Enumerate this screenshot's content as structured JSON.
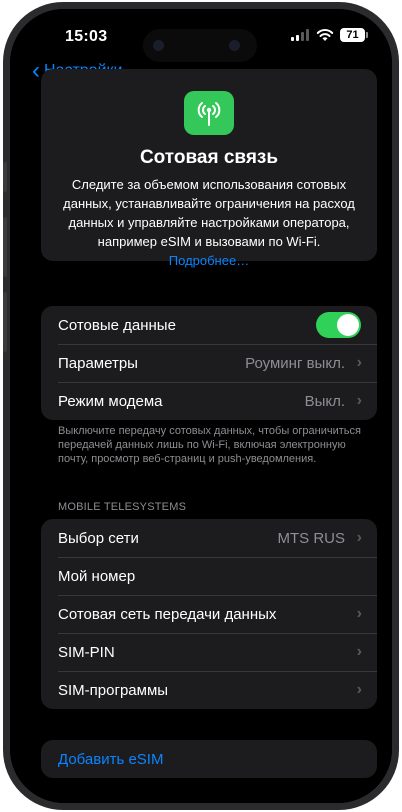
{
  "status_bar": {
    "time": "15:03",
    "battery": "71"
  },
  "nav": {
    "back_label": "Настройки"
  },
  "hero": {
    "title": "Сотовая связь",
    "description": "Следите за объемом использования сотовых данных, устанавливайте ограничения на расход данных и управляйте настройками оператора, например eSIM и вызовами по Wi-Fi.",
    "link": "Подробнее…",
    "icon": "antenna-icon"
  },
  "group1": [
    {
      "label": "Сотовые данные",
      "toggle": true
    },
    {
      "label": "Параметры",
      "value": "Роуминг выкл."
    },
    {
      "label": "Режим модема",
      "value": "Выкл."
    }
  ],
  "footnote": "Выключите передачу сотовых данных, чтобы ограничиться передачей данных лишь по Wi-Fi, включая электронную почту, просмотр веб-страниц и push-уведомления.",
  "carrier_header": "MOBILE TELESYSTEMS",
  "group2": [
    {
      "label": "Выбор сети",
      "value": "MTS RUS"
    },
    {
      "label": "Мой номер"
    },
    {
      "label": "Сотовая сеть передачи данных"
    },
    {
      "label": "SIM-PIN"
    },
    {
      "label": "SIM-программы"
    }
  ],
  "add_esim": "Добавить eSIM",
  "colors": {
    "accent": "#0a84ff",
    "toggle_on": "#30d158",
    "icon_bg": "#34c759"
  }
}
